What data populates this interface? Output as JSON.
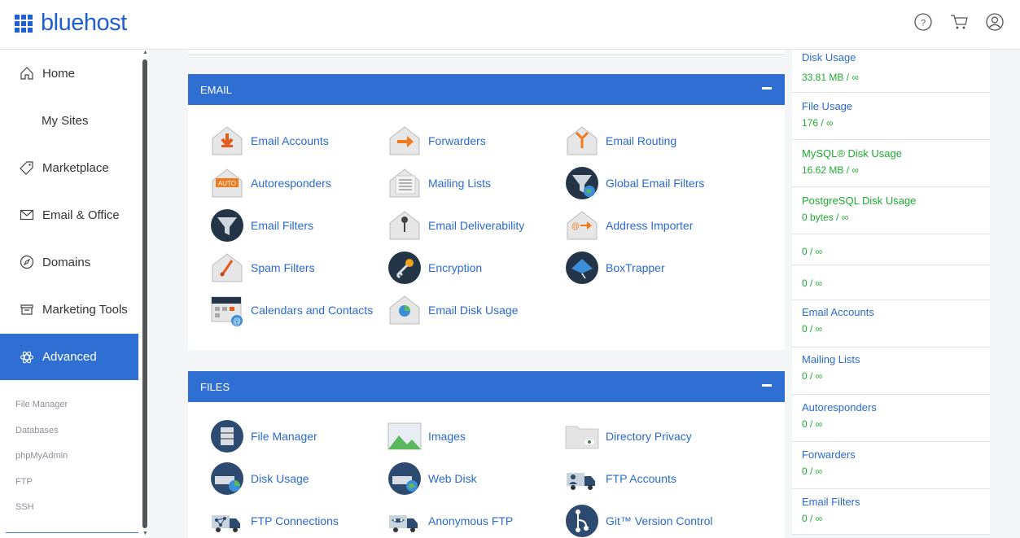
{
  "header": {
    "brand": "bluehost",
    "icons": [
      "help-icon",
      "cart-icon",
      "account-icon"
    ]
  },
  "sidebar": {
    "items": [
      {
        "label": "Home",
        "icon": "home-icon"
      },
      {
        "label": "My Sites",
        "icon": ""
      },
      {
        "label": "Marketplace",
        "icon": "tag-icon"
      },
      {
        "label": "Email & Office",
        "icon": "envelope-icon"
      },
      {
        "label": "Domains",
        "icon": "compass-icon"
      },
      {
        "label": "Marketing Tools",
        "icon": "store-icon"
      },
      {
        "label": "Advanced",
        "icon": "atom-icon"
      }
    ],
    "subitems": [
      "File Manager",
      "Databases",
      "phpMyAdmin",
      "FTP",
      "SSH"
    ]
  },
  "email_section": {
    "title": "EMAIL",
    "items": [
      "Email Accounts",
      "Forwarders",
      "Email Routing",
      "Autoresponders",
      "Mailing Lists",
      "Global Email Filters",
      "Email Filters",
      "Email Deliverability",
      "Address Importer",
      "Spam Filters",
      "Encryption",
      "BoxTrapper",
      "Calendars and Contacts",
      "Email Disk Usage"
    ]
  },
  "files_section": {
    "title": "FILES",
    "items": [
      "File Manager",
      "Images",
      "Directory Privacy",
      "Disk Usage",
      "Web Disk",
      "FTP Accounts",
      "FTP Connections",
      "Anonymous FTP",
      "Git™ Version Control"
    ]
  },
  "stats": [
    {
      "label": "Disk Usage",
      "value": "33.81 MB / ∞",
      "green": false
    },
    {
      "label": "File Usage",
      "value": "176 / ∞",
      "green": false
    },
    {
      "label": "MySQL® Disk Usage",
      "value": "16.62 MB / ∞",
      "green": true
    },
    {
      "label": "PostgreSQL Disk Usage",
      "value": "0 bytes / ∞",
      "green": true
    },
    {
      "label": "",
      "value": "0 / ∞",
      "green": false
    },
    {
      "label": "",
      "value": "0 / ∞",
      "green": false
    },
    {
      "label": "Email Accounts",
      "value": "0 / ∞",
      "green": false
    },
    {
      "label": "Mailing Lists",
      "value": "0 / ∞",
      "green": false
    },
    {
      "label": "Autoresponders",
      "value": "0 / ∞",
      "green": false
    },
    {
      "label": "Forwarders",
      "value": "0 / ∞",
      "green": false
    },
    {
      "label": "Email Filters",
      "value": "0 / ∞",
      "green": false
    }
  ],
  "colors": {
    "accent": "#2f6fd4",
    "link": "#2a6ad0",
    "good": "#1dac2f"
  }
}
